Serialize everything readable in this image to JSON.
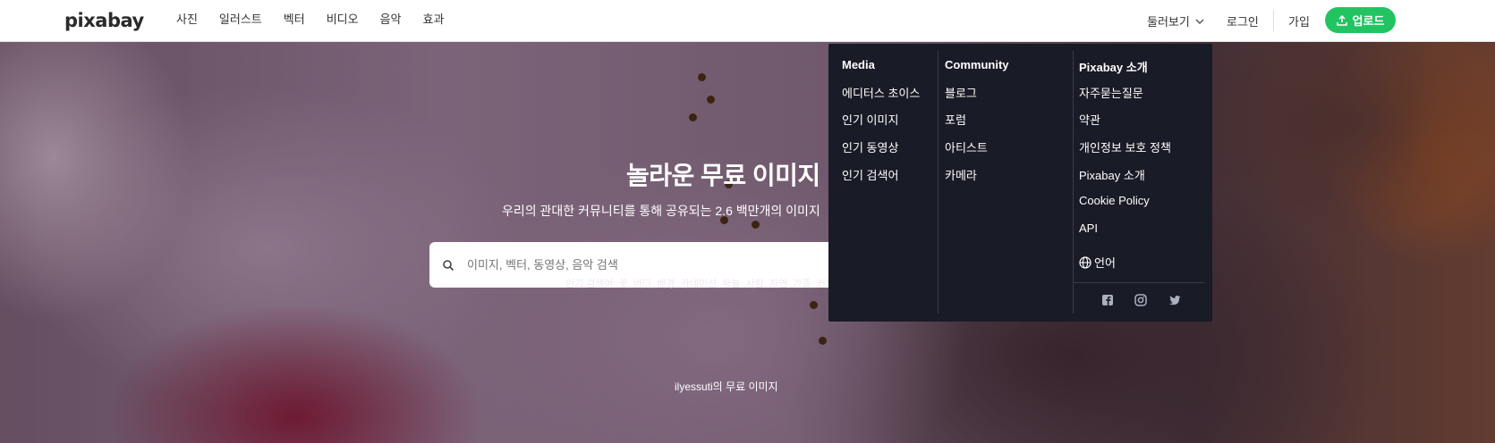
{
  "header": {
    "logo": "pixabay",
    "nav": [
      "사진",
      "일러스트",
      "벡터",
      "비디오",
      "음악",
      "효과"
    ],
    "explore": "둘러보기",
    "login": "로그인",
    "join": "가입",
    "upload": "업로드",
    "accent_color": "#22c462"
  },
  "hero": {
    "title": "놀라운 무료 이미지",
    "subtitle": "우리의 관대한 커뮤니티를 통해 공유되는 2.6 백만개의 이미지",
    "search_placeholder": "이미지, 벡터, 동영상, 음악 검색",
    "popular_searches": "인기 검색어: 꽃, 바다, 배경, 카네이션, 하늘, 사람, 자연, 가족, 커피",
    "credit": "ilyessuti의 무료 이미지"
  },
  "dropdown": {
    "media": {
      "heading": "Media",
      "items": [
        "에디터스 초이스",
        "인기 이미지",
        "인기 동영상",
        "인기 검색어"
      ]
    },
    "community": {
      "heading": "Community",
      "items": [
        "블로그",
        "포럼",
        "아티스트",
        "카메라"
      ]
    },
    "about": {
      "heading": "Pixabay 소개",
      "items": [
        "자주묻는질문",
        "약관",
        "개인정보 보호 정책",
        "Pixabay 소개",
        "Cookie Policy",
        "API"
      ],
      "language": "언어"
    },
    "social": [
      "facebook-icon",
      "instagram-icon",
      "twitter-icon"
    ]
  }
}
